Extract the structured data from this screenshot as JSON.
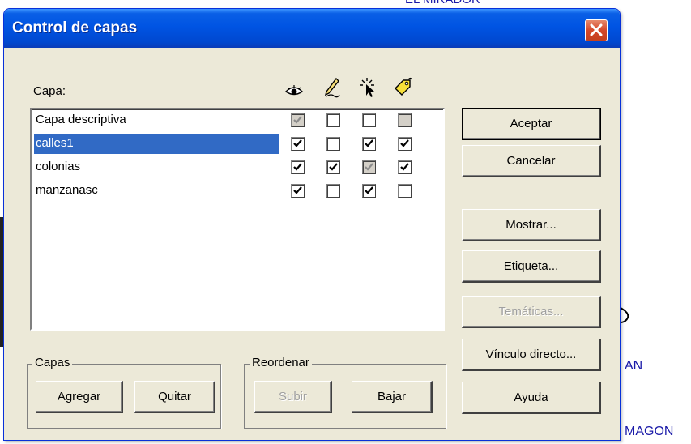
{
  "background": {
    "top_text": "EL MIRADOR",
    "right_text_1": "AN",
    "right_text_2": "MAGON"
  },
  "dialog": {
    "title": "Control de capas",
    "close_icon": "close-icon"
  },
  "layers": {
    "header_label": "Capa:",
    "column_icons": [
      "eye-icon",
      "pencil-icon",
      "select-cursor-icon",
      "label-tag-icon"
    ],
    "rows": [
      {
        "name": "Capa descriptiva",
        "selected": false,
        "visible": {
          "checked": true,
          "disabled": true
        },
        "editable": {
          "checked": false,
          "disabled": false
        },
        "selectable": {
          "checked": false,
          "disabled": false
        },
        "labeled": {
          "checked": false,
          "disabled": true
        }
      },
      {
        "name": "calles1",
        "selected": true,
        "visible": {
          "checked": true,
          "disabled": false
        },
        "editable": {
          "checked": false,
          "disabled": false
        },
        "selectable": {
          "checked": true,
          "disabled": false
        },
        "labeled": {
          "checked": true,
          "disabled": false
        }
      },
      {
        "name": "colonias",
        "selected": false,
        "visible": {
          "checked": true,
          "disabled": false
        },
        "editable": {
          "checked": true,
          "disabled": false
        },
        "selectable": {
          "checked": true,
          "disabled": true
        },
        "labeled": {
          "checked": true,
          "disabled": false
        }
      },
      {
        "name": "manzanasc",
        "selected": false,
        "visible": {
          "checked": true,
          "disabled": false
        },
        "editable": {
          "checked": false,
          "disabled": false
        },
        "selectable": {
          "checked": true,
          "disabled": false
        },
        "labeled": {
          "checked": false,
          "disabled": false
        }
      }
    ]
  },
  "buttons": {
    "aceptar": "Aceptar",
    "cancelar": "Cancelar",
    "mostrar": "Mostrar...",
    "etiqueta": "Etiqueta...",
    "tematicas": "Temáticas...",
    "vinculo": "Vínculo directo...",
    "ayuda": "Ayuda"
  },
  "capas_group": {
    "title": "Capas",
    "agregar": "Agregar",
    "quitar": "Quitar"
  },
  "reordenar_group": {
    "title": "Reordenar",
    "subir": "Subir",
    "bajar": "Bajar"
  },
  "colors": {
    "titlebar": "#0054e3",
    "selection": "#316ac5",
    "dialog_bg": "#ece9d8"
  }
}
